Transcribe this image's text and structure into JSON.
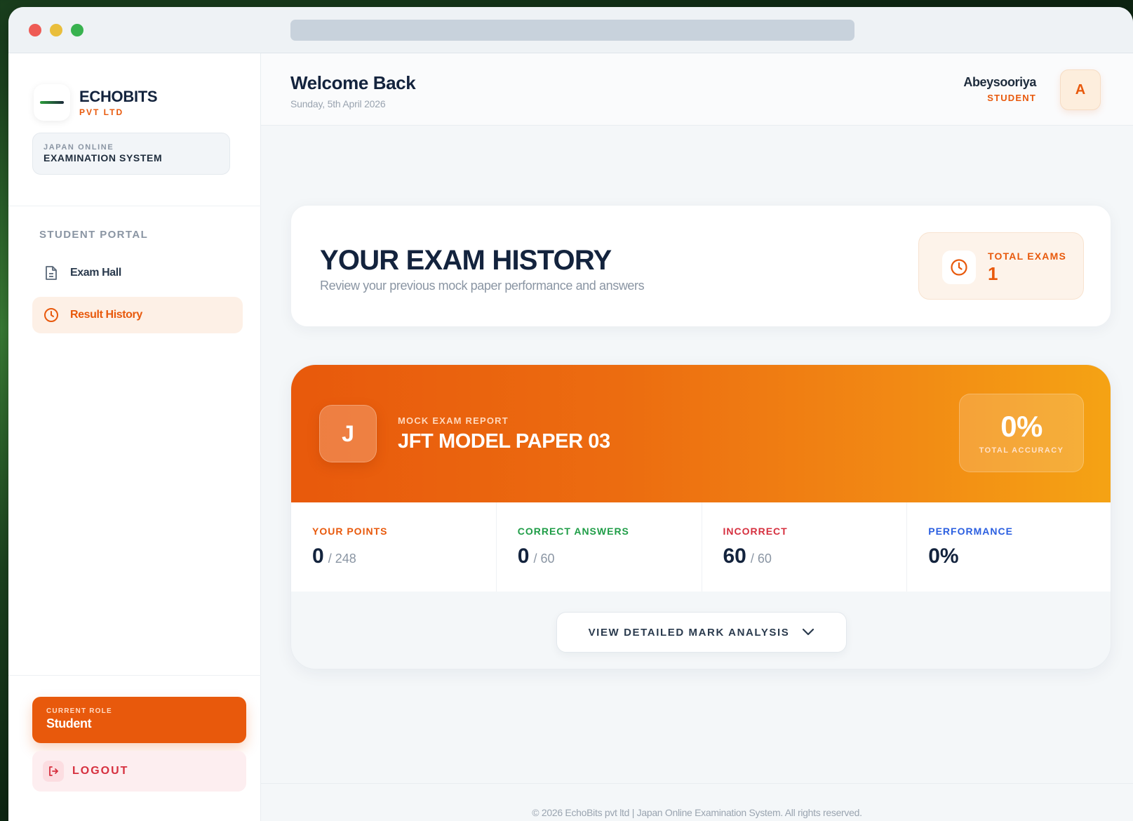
{
  "sidebar": {
    "brand_name": "ECHOBITS",
    "brand_sub": "PVT LTD",
    "system_small": "JAPAN ONLINE",
    "system_big": "EXAMINATION SYSTEM",
    "portal_label": "STUDENT PORTAL",
    "items": [
      {
        "label": "Exam Hall",
        "icon": "document-icon"
      },
      {
        "label": "Result History",
        "icon": "clock-icon",
        "active": true
      }
    ],
    "role_small": "CURRENT ROLE",
    "role_value": "Student",
    "logout_label": "LOGOUT"
  },
  "header": {
    "welcome": "Welcome Back",
    "date": "Sunday, 5th April 2026",
    "user_name": "Abeysooriya",
    "user_role": "STUDENT",
    "avatar_initial": "A"
  },
  "history": {
    "title": "YOUR EXAM HISTORY",
    "subtitle": "Review your previous mock paper performance and answers",
    "total_label": "TOTAL EXAMS",
    "total_value": "1"
  },
  "report": {
    "badge": "J",
    "kicker": "MOCK EXAM REPORT",
    "title": "JFT MODEL PAPER 03",
    "accuracy_value": "0%",
    "accuracy_label": "TOTAL ACCURACY",
    "stats": [
      {
        "label": "YOUR POINTS",
        "value": "0",
        "total": "/ 248"
      },
      {
        "label": "CORRECT ANSWERS",
        "value": "0",
        "total": "/ 60"
      },
      {
        "label": "INCORRECT",
        "value": "60",
        "total": "/ 60"
      },
      {
        "label": "PERFORMANCE",
        "value": "0%",
        "total": ""
      }
    ],
    "analysis_label": "VIEW DETAILED MARK ANALYSIS"
  },
  "footer": {
    "text": "© 2026 EchoBits pvt ltd | Japan Online Examination System. All rights reserved."
  },
  "colors": {
    "accent": "#e8590c",
    "navy": "#13233d",
    "correct": "#1f9d47",
    "incorrect": "#d6303f",
    "performance": "#2b5fe0"
  }
}
